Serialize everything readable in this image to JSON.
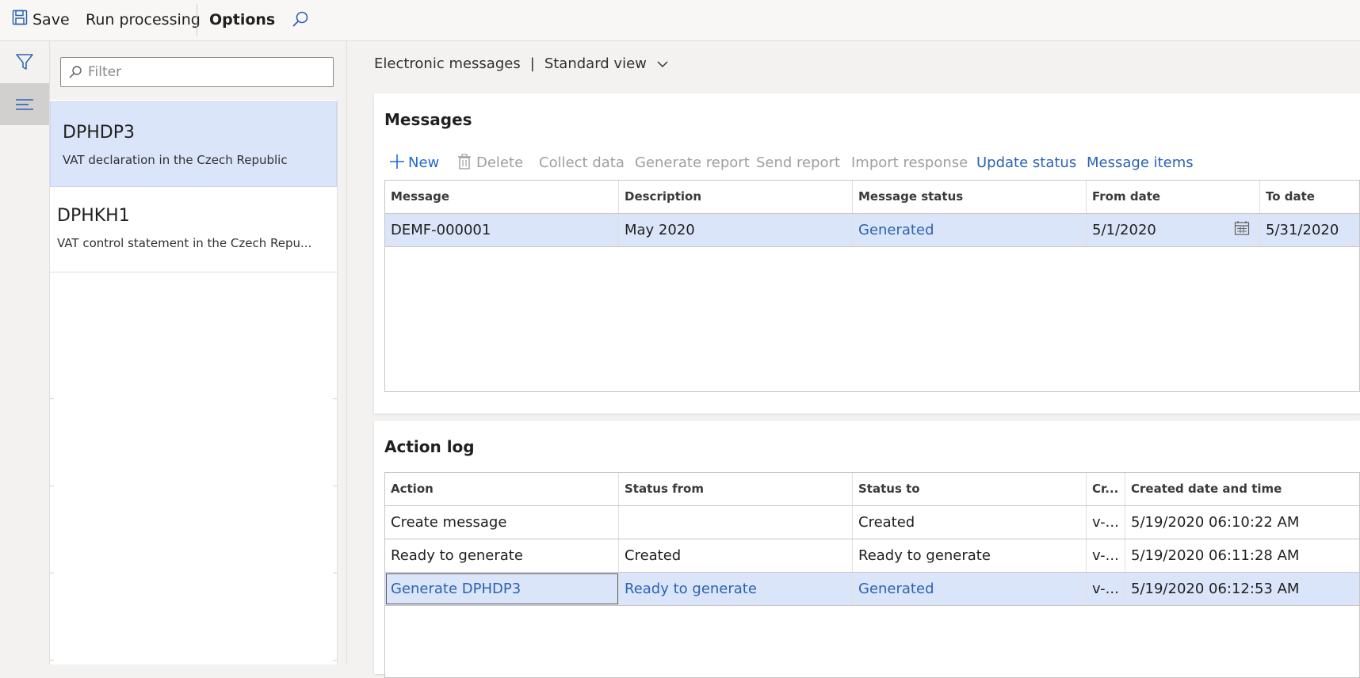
{
  "toolbar": {
    "save_label": "Save",
    "run_label": "Run processing",
    "options_label": "Options"
  },
  "nav": {
    "filter_icon": "filter-icon",
    "list_icon": "list-icon"
  },
  "list": {
    "filter_placeholder": "Filter",
    "items": [
      {
        "title": "DPHDP3",
        "subtitle": "VAT declaration in the Czech Republic"
      },
      {
        "title": "DPHKH1",
        "subtitle": "VAT control statement in the Czech Repu..."
      }
    ]
  },
  "breadcrumb": {
    "page": "Electronic messages",
    "separator": "|",
    "view": "Standard view"
  },
  "messages": {
    "title": "Messages",
    "actions": {
      "new": "New",
      "delete": "Delete",
      "collect": "Collect data",
      "generate": "Generate report",
      "send": "Send report",
      "import": "Import response",
      "update": "Update status",
      "items": "Message items"
    },
    "columns": [
      "Message",
      "Description",
      "Message status",
      "From date",
      "To date"
    ],
    "rows": [
      {
        "message": "DEMF-000001",
        "description": "May 2020",
        "status": "Generated",
        "from": "5/1/2020",
        "to": "5/31/2020"
      }
    ]
  },
  "action_log": {
    "title": "Action log",
    "columns": [
      "Action",
      "Status from",
      "Status to",
      "Cr...",
      "Created date and time"
    ],
    "rows": [
      {
        "action": "Create message",
        "from": "",
        "to": "Created",
        "cr": "v-...",
        "time": "5/19/2020 06:10:22 AM"
      },
      {
        "action": "Ready to generate",
        "from": "Created",
        "to": "Ready to generate",
        "cr": "v-...",
        "time": "5/19/2020 06:11:28 AM"
      },
      {
        "action": "Generate DPHDP3",
        "from": "Ready to generate",
        "to": "Generated",
        "cr": "v-...",
        "time": "5/19/2020 06:12:53 AM"
      }
    ]
  },
  "colors": {
    "accent": "#2c62b0",
    "selected_row": "#dbe5f9",
    "disabled": "#a19f9d"
  }
}
